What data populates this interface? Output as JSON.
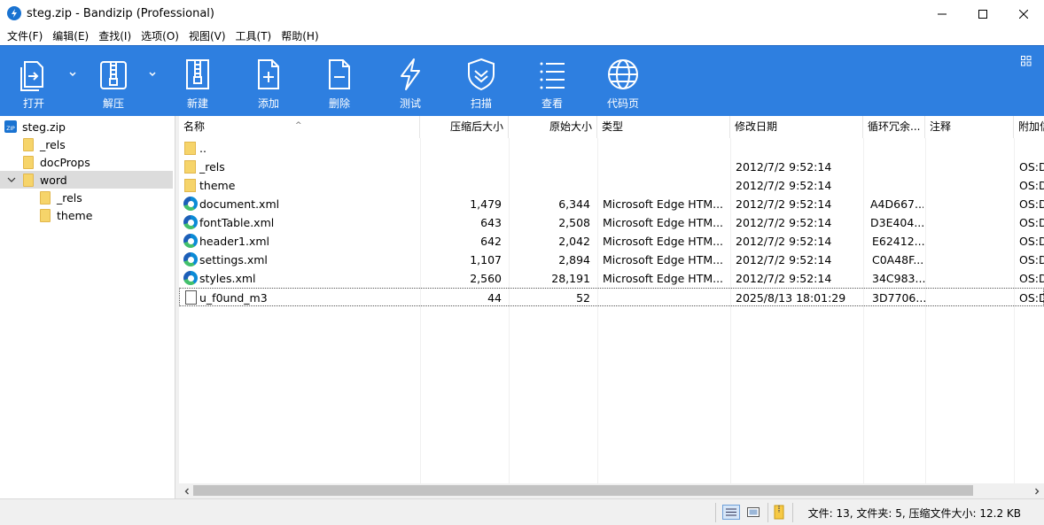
{
  "window": {
    "title": "steg.zip - Bandizip (Professional)"
  },
  "menu": [
    "文件(F)",
    "编辑(E)",
    "查找(I)",
    "选项(O)",
    "视图(V)",
    "工具(T)",
    "帮助(H)"
  ],
  "toolbar": {
    "open": "打开",
    "extract": "解压",
    "new": "新建",
    "add": "添加",
    "delete": "删除",
    "test": "测试",
    "scan": "扫描",
    "view": "查看",
    "codepage": "代码页"
  },
  "tree": {
    "root": "steg.zip",
    "items": [
      {
        "label": "_rels"
      },
      {
        "label": "docProps"
      },
      {
        "label": "word"
      },
      {
        "label": "_rels"
      },
      {
        "label": "theme"
      }
    ]
  },
  "columns": [
    "名称",
    "压缩后大小",
    "原始大小",
    "类型",
    "修改日期",
    "循环冗余...",
    "注释",
    "附加信"
  ],
  "files": [
    {
      "name": "..",
      "packed": "",
      "size": "",
      "type": "",
      "modified": "",
      "crc": "",
      "comment": "",
      "attr": ""
    },
    {
      "name": "_rels",
      "packed": "",
      "size": "",
      "type": "",
      "modified": "2012/7/2 9:52:14",
      "crc": "",
      "comment": "",
      "attr": "OS:D"
    },
    {
      "name": "theme",
      "packed": "",
      "size": "",
      "type": "",
      "modified": "2012/7/2 9:52:14",
      "crc": "",
      "comment": "",
      "attr": "OS:D"
    },
    {
      "name": "document.xml",
      "packed": "1,479",
      "size": "6,344",
      "type": "Microsoft Edge HTM...",
      "modified": "2012/7/2 9:52:14",
      "crc": "A4D667...",
      "comment": "",
      "attr": "OS:D"
    },
    {
      "name": "fontTable.xml",
      "packed": "643",
      "size": "2,508",
      "type": "Microsoft Edge HTM...",
      "modified": "2012/7/2 9:52:14",
      "crc": "D3E404...",
      "comment": "",
      "attr": "OS:D"
    },
    {
      "name": "header1.xml",
      "packed": "642",
      "size": "2,042",
      "type": "Microsoft Edge HTM...",
      "modified": "2012/7/2 9:52:14",
      "crc": "E62412...",
      "comment": "",
      "attr": "OS:D"
    },
    {
      "name": "settings.xml",
      "packed": "1,107",
      "size": "2,894",
      "type": "Microsoft Edge HTM...",
      "modified": "2012/7/2 9:52:14",
      "crc": "C0A48F...",
      "comment": "",
      "attr": "OS:D"
    },
    {
      "name": "styles.xml",
      "packed": "2,560",
      "size": "28,191",
      "type": "Microsoft Edge HTM...",
      "modified": "2012/7/2 9:52:14",
      "crc": "34C983...",
      "comment": "",
      "attr": "OS:D"
    },
    {
      "name": "u_f0und_m3",
      "packed": "44",
      "size": "52",
      "type": "",
      "modified": "2025/8/13 18:01:29",
      "crc": "3D7706...",
      "comment": "",
      "attr": "OS:D"
    }
  ],
  "status": {
    "summary": "文件: 13, 文件夹: 5, 压缩文件大小: 12.2 KB"
  },
  "colors": {
    "toolbar_bg": "#2e7fe0",
    "selection": "#dcdcdc",
    "folder": "#f6d46a"
  }
}
